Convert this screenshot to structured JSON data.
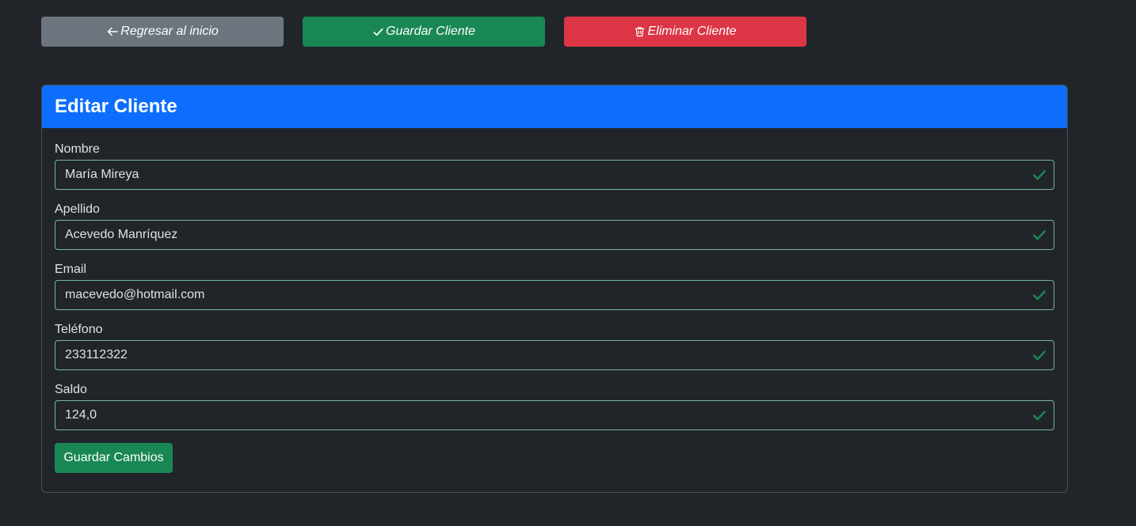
{
  "toolbar": {
    "back_label": "Regresar al inicio",
    "save_label": "Guardar Cliente",
    "delete_label": "Eliminar Cliente"
  },
  "icons": {
    "back": "arrow-left-icon",
    "save": "check-icon",
    "delete": "trash-icon",
    "valid": "check-valid-icon"
  },
  "colors": {
    "background": "#212529",
    "secondary": "#6c757d",
    "success": "#198754",
    "danger": "#dc3545",
    "primary": "#0d6efd",
    "valid_border": "#75b798"
  },
  "card": {
    "title": "Editar Cliente"
  },
  "form": {
    "nombre": {
      "label": "Nombre",
      "value": "María Mireya"
    },
    "apellido": {
      "label": "Apellido",
      "value": "Acevedo Manríquez"
    },
    "email": {
      "label": "Email",
      "value": "macevedo@hotmail.com"
    },
    "telefono": {
      "label": "Teléfono",
      "value": "233112322"
    },
    "saldo": {
      "label": "Saldo",
      "value": "124,0"
    },
    "submit_label": "Guardar Cambios"
  }
}
